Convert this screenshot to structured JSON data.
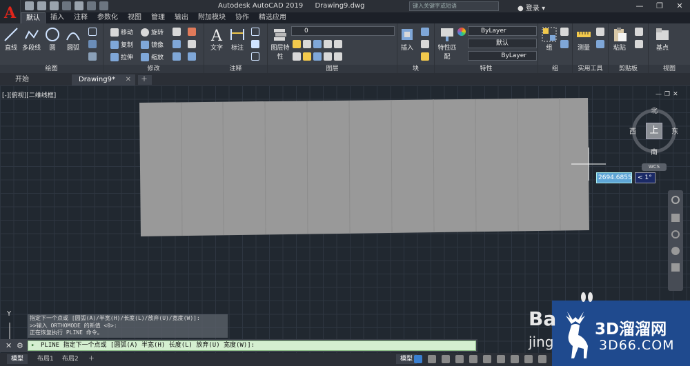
{
  "app": {
    "logo_letter": "A",
    "title_app": "Autodesk AutoCAD 2019",
    "title_file": "Drawing9.dwg",
    "search_placeholder": "键入关键字或短语",
    "login_label": "登录"
  },
  "ribbon_tabs": [
    "默认",
    "插入",
    "注释",
    "参数化",
    "视图",
    "管理",
    "输出",
    "附加模块",
    "协作",
    "精选应用"
  ],
  "ribbon": {
    "draw": {
      "title": "绘图",
      "tools": [
        "直线",
        "多段线",
        "圆",
        "圆弧"
      ]
    },
    "modify": {
      "title": "修改",
      "tools": [
        "移动",
        "旋转",
        "复制",
        "镜像",
        "拉伸",
        "缩放"
      ]
    },
    "annotation": {
      "title": "注释",
      "tools": [
        "文字",
        "标注"
      ]
    },
    "layers": {
      "title": "图层",
      "tool": "图层特性",
      "current_layer": "0"
    },
    "block": {
      "title": "块",
      "tool": "插入"
    },
    "properties": {
      "title": "特性",
      "tool": "特性匹配",
      "color": "ByLayer",
      "linetype": "默认",
      "lineweight": "ByLayer"
    },
    "groups": {
      "title": "组",
      "tool": "组"
    },
    "utilities": {
      "title": "实用工具",
      "tool": "测量"
    },
    "clipboard": {
      "title": "剪贴板",
      "tool": "粘贴"
    },
    "view": {
      "title": "视图",
      "tool": "基点"
    }
  },
  "doc_tabs": [
    "开始",
    "Drawing9*"
  ],
  "viewport": {
    "label": "[-][俯视][二维线框]",
    "viewcube": {
      "north": "北",
      "south": "南",
      "east": "东",
      "west": "西",
      "face": "上",
      "ucs": "WCS"
    },
    "dynamic_input": {
      "length": "2694.6855",
      "angle": "< 1°"
    },
    "ucs_y": "Y"
  },
  "command": {
    "history": [
      "指定下一个点或 [圆弧(A)/半宽(H)/长度(L)/放弃(U)/宽度(W)]:",
      ">>输入 ORTHOMODE 的新值 <0>:",
      "正在恢复执行 PLINE 命令。"
    ],
    "prompt": "PLINE 指定下一个点或 [圆弧(A) 半宽(H) 长度(L) 放弃(U) 宽度(W)]:"
  },
  "layout_tabs": [
    "模型",
    "布局1",
    "布局2"
  ],
  "status": {
    "model_label": "模型"
  },
  "watermark": {
    "site_cn": "3D溜溜网",
    "site_url": "3D66.COM",
    "baidu_partial": "Ba",
    "jing_partial": "jing"
  },
  "colors": {
    "shape_fill": "#999999",
    "cmd_input_bg": "#d4efd0",
    "watermark_bg": "#1f4a8e"
  }
}
